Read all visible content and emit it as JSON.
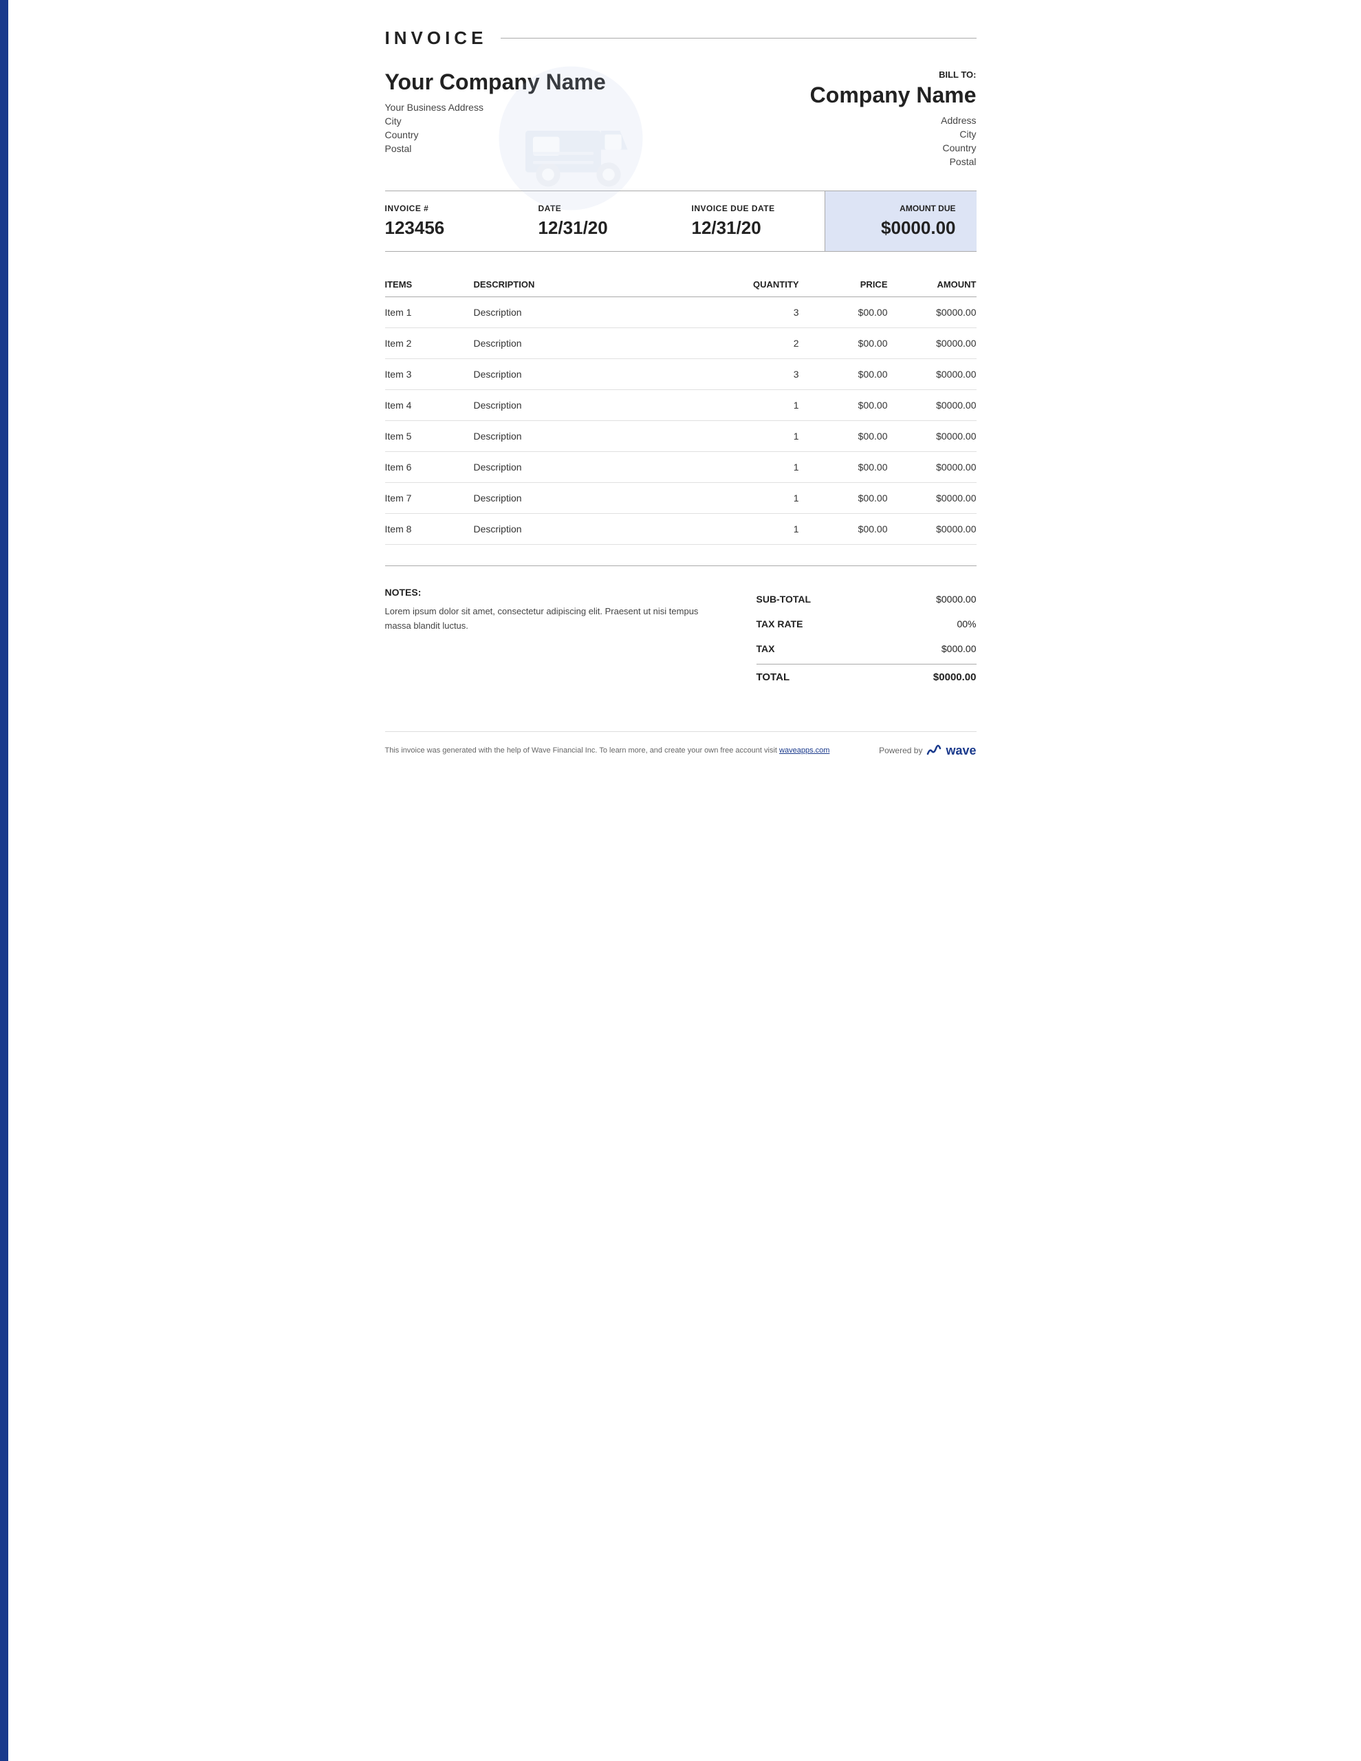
{
  "document": {
    "title": "INVOICE"
  },
  "company": {
    "name": "Your Company Name",
    "address": "Your Business Address",
    "city": "City",
    "country": "Country",
    "postal": "Postal"
  },
  "bill_to": {
    "label": "BILL TO:",
    "name": "Company Name",
    "address": "Address",
    "city": "City",
    "country": "Country",
    "postal": "Postal"
  },
  "meta": {
    "invoice_number_label": "INVOICE #",
    "invoice_number": "123456",
    "date_label": "DATE",
    "date": "12/31/20",
    "due_date_label": "INVOICE DUE DATE",
    "due_date": "12/31/20",
    "amount_due_label": "AMOUNT DUE",
    "amount_due": "$0000.00"
  },
  "table": {
    "headers": {
      "items": "ITEMS",
      "description": "DESCRIPTION",
      "quantity": "QUANTITY",
      "price": "PRICE",
      "amount": "AMOUNT"
    },
    "rows": [
      {
        "item": "Item 1",
        "description": "Description",
        "quantity": "3",
        "price": "$00.00",
        "amount": "$0000.00"
      },
      {
        "item": "Item 2",
        "description": "Description",
        "quantity": "2",
        "price": "$00.00",
        "amount": "$0000.00"
      },
      {
        "item": "Item 3",
        "description": "Description",
        "quantity": "3",
        "price": "$00.00",
        "amount": "$0000.00"
      },
      {
        "item": "Item 4",
        "description": "Description",
        "quantity": "1",
        "price": "$00.00",
        "amount": "$0000.00"
      },
      {
        "item": "Item 5",
        "description": "Description",
        "quantity": "1",
        "price": "$00.00",
        "amount": "$0000.00"
      },
      {
        "item": "Item 6",
        "description": "Description",
        "quantity": "1",
        "price": "$00.00",
        "amount": "$0000.00"
      },
      {
        "item": "Item 7",
        "description": "Description",
        "quantity": "1",
        "price": "$00.00",
        "amount": "$0000.00"
      },
      {
        "item": "Item 8",
        "description": "Description",
        "quantity": "1",
        "price": "$00.00",
        "amount": "$0000.00"
      }
    ]
  },
  "notes": {
    "label": "NOTES:",
    "text": "Lorem ipsum dolor sit amet, consectetur adipiscing elit. Praesent ut nisi tempus massa blandit luctus."
  },
  "totals": {
    "subtotal_label": "SUB-TOTAL",
    "subtotal_value": "$0000.00",
    "tax_rate_label": "TAX RATE",
    "tax_rate_value": "00%",
    "tax_label": "TAX",
    "tax_value": "$000.00",
    "total_label": "TOTAL",
    "total_value": "$0000.00"
  },
  "footer": {
    "text": "This invoice was generated with the help of Wave Financial Inc. To learn more, and create your own free account visit",
    "link_text": "waveapps.com",
    "powered_label": "Powered by",
    "brand": "wave"
  },
  "colors": {
    "accent": "#1a3a8c",
    "amount_due_bg": "#dde4f5"
  }
}
